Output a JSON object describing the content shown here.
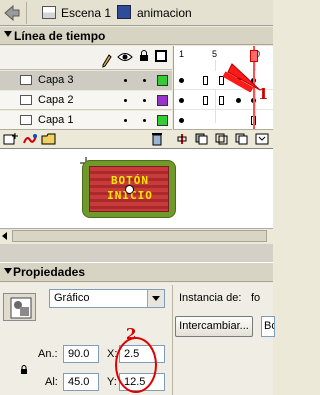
{
  "topbar": {
    "scene_label": "Escena 1",
    "symbol_label": "animacion"
  },
  "timeline": {
    "title": "Línea de tiempo",
    "frame_numbers": [
      "1",
      "5",
      "10"
    ],
    "layers": [
      {
        "name": "Capa 3",
        "selected": true,
        "color": "#33cc33"
      },
      {
        "name": "Capa 2",
        "selected": false,
        "color": "#9933cc"
      },
      {
        "name": "Capa 1",
        "selected": false,
        "color": "#33cc33"
      }
    ],
    "current_frame": 10
  },
  "stage": {
    "button_line1": "BOTÓN",
    "button_line2": "INICIO"
  },
  "properties": {
    "title": "Propiedades",
    "behavior": "Gráfico",
    "instance_label": "Instancia de:",
    "instance_name": "fo",
    "swap_button": "Intercambiar...",
    "instance_field_value": "Bo",
    "width_label": "An.:",
    "width_value": "90.0",
    "height_label": "Al:",
    "height_value": "45.0",
    "x_label": "X:",
    "x_value": "2.5",
    "y_label": "Y:",
    "y_value": "12.5"
  },
  "annotations": {
    "marker_1": "1",
    "marker_2": "2"
  },
  "colors": {
    "annotation": "#e00000",
    "playhead": "#ff5050"
  }
}
